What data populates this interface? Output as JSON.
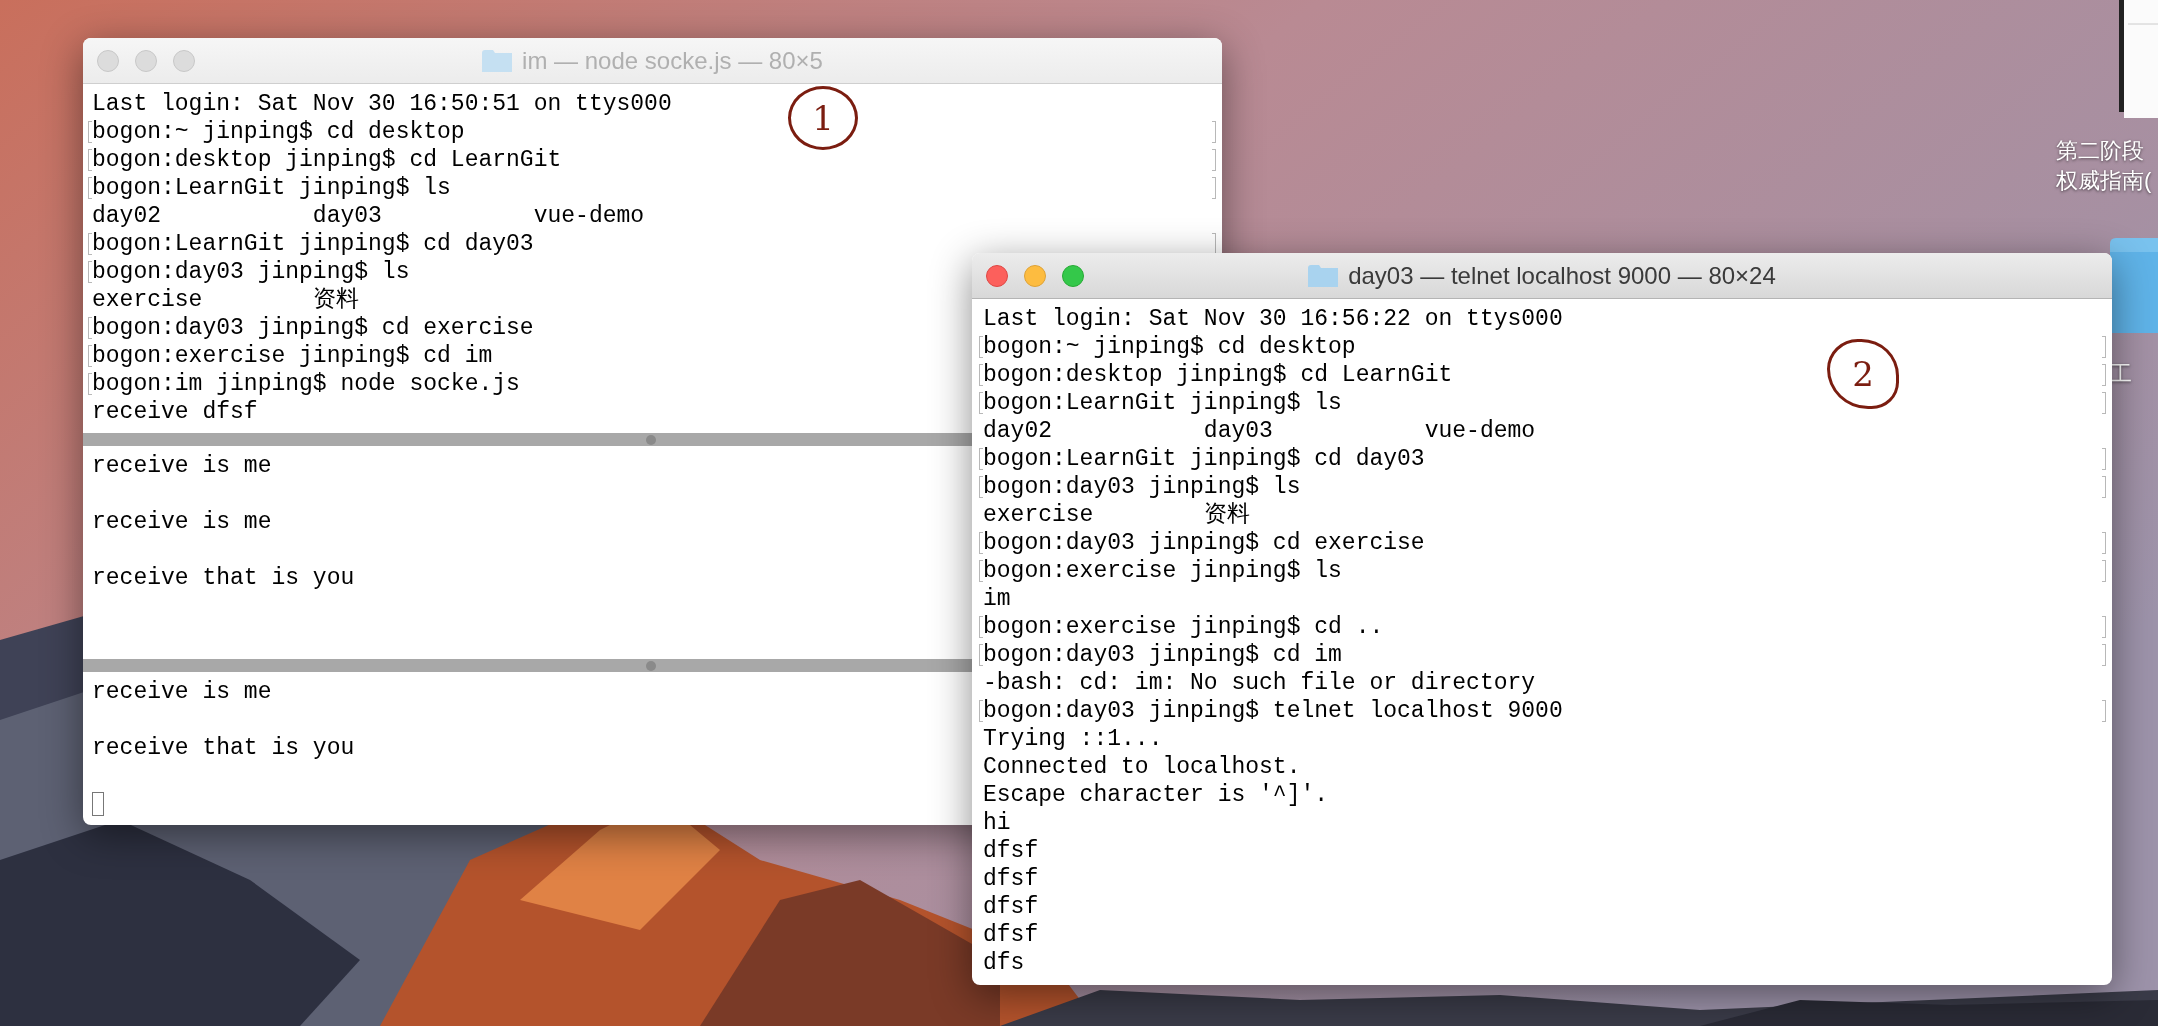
{
  "desktop": {
    "icons": [
      {
        "kind": "document",
        "label_lines": [
          "第二阶段",
          "权威指南("
        ]
      },
      {
        "kind": "folder",
        "label_lines": [
          "工"
        ]
      }
    ]
  },
  "windows": [
    {
      "title": "im — node socke.js — 80×5",
      "active": false,
      "annotation": "1",
      "panes": [
        {
          "lines": [
            {
              "text": "Last login: Sat Nov 30 16:50:51 on ttys000",
              "mark": false,
              "end_mark": false
            },
            {
              "text": "bogon:~ jinping$ cd desktop",
              "mark": true,
              "end_mark": true
            },
            {
              "text": "bogon:desktop jinping$ cd LearnGit",
              "mark": true,
              "end_mark": true
            },
            {
              "text": "bogon:LearnGit jinping$ ls",
              "mark": true,
              "end_mark": true
            },
            {
              "text": "day02           day03           vue-demo",
              "mark": false,
              "end_mark": false
            },
            {
              "text": "bogon:LearnGit jinping$ cd day03",
              "mark": true,
              "end_mark": true
            },
            {
              "text": "bogon:day03 jinping$ ls",
              "mark": true
            },
            {
              "text": "exercise        资料",
              "mark": false
            },
            {
              "text": "bogon:day03 jinping$ cd exercise",
              "mark": true
            },
            {
              "text": "bogon:exercise jinping$ cd im",
              "mark": true
            },
            {
              "text": "bogon:im jinping$ node socke.js",
              "mark": true
            },
            {
              "text": "receive dfsf",
              "mark": false
            }
          ]
        },
        {
          "lines": [
            {
              "text": "receive is me"
            },
            {
              "text": "receive is me",
              "blank_before": true
            },
            {
              "text": "receive that is you",
              "blank_before": true
            }
          ]
        },
        {
          "lines": [
            {
              "text": "receive is me"
            },
            {
              "text": "receive that is you",
              "blank_before": true
            },
            {
              "kind": "cursor"
            }
          ]
        }
      ]
    },
    {
      "title": "day03 — telnet localhost 9000 — 80×24",
      "active": true,
      "annotation": "2",
      "panes": [
        {
          "lines": [
            {
              "text": "Last login: Sat Nov 30 16:56:22 on ttys000"
            },
            {
              "text": "bogon:~ jinping$ cd desktop",
              "mark": true,
              "end_mark": true
            },
            {
              "text": "bogon:desktop jinping$ cd LearnGit",
              "mark": true,
              "end_mark": true
            },
            {
              "text": "bogon:LearnGit jinping$ ls",
              "mark": true,
              "end_mark": true
            },
            {
              "text": "day02           day03           vue-demo",
              "mark": false,
              "end_mark": false
            },
            {
              "text": "bogon:LearnGit jinping$ cd day03",
              "mark": true,
              "end_mark": true
            },
            {
              "text": "bogon:day03 jinping$ ls",
              "mark": true,
              "end_mark": true
            },
            {
              "text": "exercise        资料",
              "mark": false,
              "end_mark": false
            },
            {
              "text": "bogon:day03 jinping$ cd exercise",
              "mark": true,
              "end_mark": true
            },
            {
              "text": "bogon:exercise jinping$ ls",
              "mark": true,
              "end_mark": true
            },
            {
              "text": "im",
              "mark": false,
              "end_mark": false
            },
            {
              "text": "bogon:exercise jinping$ cd ..",
              "mark": true,
              "end_mark": true
            },
            {
              "text": "bogon:day03 jinping$ cd im",
              "mark": true,
              "end_mark": true
            },
            {
              "text": "-bash: cd: im: No such file or directory",
              "mark": false,
              "end_mark": false
            },
            {
              "text": "bogon:day03 jinping$ telnet localhost 9000",
              "mark": true,
              "end_mark": true
            },
            {
              "text": "Trying ::1...",
              "mark": false,
              "end_mark": false
            },
            {
              "text": "Connected to localhost.",
              "mark": false,
              "end_mark": false
            },
            {
              "text": "Escape character is '^]'.",
              "mark": false,
              "end_mark": false
            },
            {
              "text": "hi",
              "mark": false,
              "end_mark": false
            },
            {
              "text": "dfsf",
              "mark": false,
              "end_mark": false
            },
            {
              "text": "dfsf",
              "mark": false,
              "end_mark": false
            },
            {
              "text": "dfsf",
              "mark": false,
              "end_mark": false
            },
            {
              "text": "dfsf",
              "mark": false,
              "end_mark": false
            },
            {
              "text": "dfs",
              "mark": false,
              "end_mark": false
            }
          ]
        }
      ]
    }
  ]
}
